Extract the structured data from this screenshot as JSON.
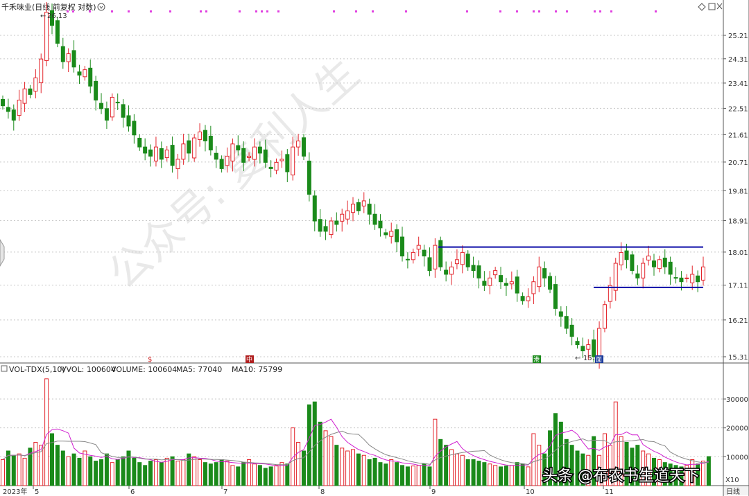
{
  "header": {
    "title": "千禾味业(日线 前复权 对数)",
    "icons": [
      "circle-icon",
      "diamond-icon",
      "square-icon",
      "close-icon"
    ]
  },
  "price_axis": {
    "ticks": [
      "25.21",
      "24.31",
      "23.41",
      "22.51",
      "21.61",
      "20.71",
      "19.81",
      "18.91",
      "18.01",
      "17.11",
      "16.21",
      "15.31"
    ]
  },
  "annotations": {
    "high": "26.13",
    "low": "15.31"
  },
  "price_markers": [
    "$",
    "中",
    "港",
    "面"
  ],
  "volume_header": {
    "indicator": "VOL-TDX(5,10)",
    "vvol": "VVOL: 100604",
    "volume": "VOLUME: 100604",
    "ma5": "MA5: 77040",
    "ma10": "MA10: 75799"
  },
  "volume_axis": {
    "ticks": [
      "30000",
      "20000",
      "10000"
    ]
  },
  "time_axis": {
    "labels": [
      "2023年",
      "5",
      "6",
      "7",
      "8",
      "9",
      "10",
      "11"
    ],
    "period_button": "日线"
  },
  "watermark": "公众号: 复利人生",
  "overlay_text": "头条 @布农书生道天下",
  "colors": {
    "up": "#e3242b",
    "down": "#1a8a1a",
    "line": "#0a0aa6",
    "ma5": "#d020d0",
    "ma10": "#888888",
    "dots": "#e040e0"
  },
  "chart_data": [
    {
      "type": "candlestick",
      "title": "千禾味业(日线 前复权 对数)",
      "scale": "log",
      "ylim": [
        15.31,
        26.13
      ],
      "x_months": [
        "5",
        "6",
        "7",
        "8",
        "9",
        "10",
        "11"
      ],
      "high_label": 26.13,
      "low_label": 15.31,
      "horizontal_lines": [
        18.15,
        17.05
      ],
      "close": [
        22.6,
        22.4,
        22.1,
        22.8,
        23.2,
        23.0,
        23.6,
        24.3,
        26.13,
        25.6,
        24.9,
        24.2,
        24.5,
        24.0,
        23.7,
        23.9,
        23.3,
        22.8,
        22.5,
        22.1,
        22.9,
        22.7,
        22.2,
        21.9,
        21.6,
        21.2,
        21.0,
        20.9,
        21.2,
        20.8,
        21.1,
        20.6,
        20.8,
        21.3,
        21.0,
        21.5,
        21.7,
        21.4,
        21.1,
        20.8,
        20.5,
        20.9,
        21.3,
        21.1,
        20.7,
        20.9,
        21.2,
        21.0,
        20.7,
        20.5,
        20.7,
        20.8,
        20.4,
        21.2,
        21.4,
        20.9,
        19.7,
        18.9,
        18.6,
        18.6,
        18.9,
        18.8,
        19.1,
        19.2,
        19.4,
        19.2,
        19.5,
        19.1,
        18.8,
        18.7,
        18.5,
        18.6,
        18.3,
        17.9,
        17.8,
        18.0,
        18.2,
        17.9,
        17.5,
        18.2,
        17.6,
        17.4,
        17.6,
        17.8,
        18.0,
        17.6,
        17.5,
        17.3,
        17.1,
        17.3,
        17.5,
        17.2,
        17.1,
        17.2,
        16.9,
        16.7,
        16.8,
        17.2,
        17.6,
        17.3,
        17.0,
        16.5,
        16.3,
        16.0,
        15.8,
        15.6,
        15.45,
        15.6,
        15.31,
        16.0,
        16.6,
        17.1,
        17.7,
        18.0,
        17.8,
        17.5,
        17.3,
        17.7,
        17.9,
        17.6,
        17.8,
        17.6,
        17.4,
        17.3,
        17.2,
        17.3,
        17.4,
        17.2,
        17.6
      ]
    },
    {
      "type": "bar",
      "title": "VOL-TDX(5,10)",
      "ylim": [
        0,
        35000
      ],
      "series": [
        {
          "name": "VOLUME",
          "values": [
            9000,
            12000,
            10500,
            11000,
            9500,
            13000,
            15000,
            14000,
            37000,
            18000,
            14000,
            12000,
            10000,
            11000,
            9500,
            12000,
            10000,
            8500,
            9000,
            11000,
            8000,
            9000,
            10000,
            12000,
            9500,
            8000,
            7000,
            8500,
            9000,
            8000,
            9500,
            10000,
            8500,
            9000,
            11000,
            10000,
            9000,
            8000,
            7500,
            8000,
            9000,
            8500,
            7000,
            6500,
            8000,
            9000,
            7500,
            7000,
            6000,
            6500,
            7000,
            8000,
            7500,
            20000,
            15000,
            12000,
            28000,
            29000,
            22000,
            19000,
            17000,
            14000,
            13000,
            12000,
            12500,
            11000,
            10500,
            9000,
            9500,
            8000,
            7500,
            9000,
            8000,
            7000,
            6500,
            6800,
            7000,
            7500,
            6500,
            23000,
            16000,
            14000,
            12500,
            11000,
            10500,
            9000,
            9000,
            8500,
            8000,
            7500,
            7000,
            6500,
            6800,
            7000,
            8000,
            7500,
            6500,
            18000,
            14000,
            11000,
            19000,
            25000,
            22000,
            16000,
            14000,
            12000,
            11000,
            10500,
            17000,
            10500,
            18000,
            14000,
            29000,
            17000,
            15000,
            13000,
            14000,
            12000,
            11000,
            9500,
            9000,
            8000,
            7500,
            7000,
            6500,
            7000,
            9000,
            7500,
            8500,
            10060
          ]
        },
        {
          "name": "MA5",
          "values": [
            77040
          ]
        },
        {
          "name": "MA10",
          "values": [
            75799
          ]
        }
      ],
      "latest": {
        "VVOL": 100604,
        "VOLUME": 100604,
        "MA5": 77040,
        "MA10": 75799
      }
    }
  ]
}
